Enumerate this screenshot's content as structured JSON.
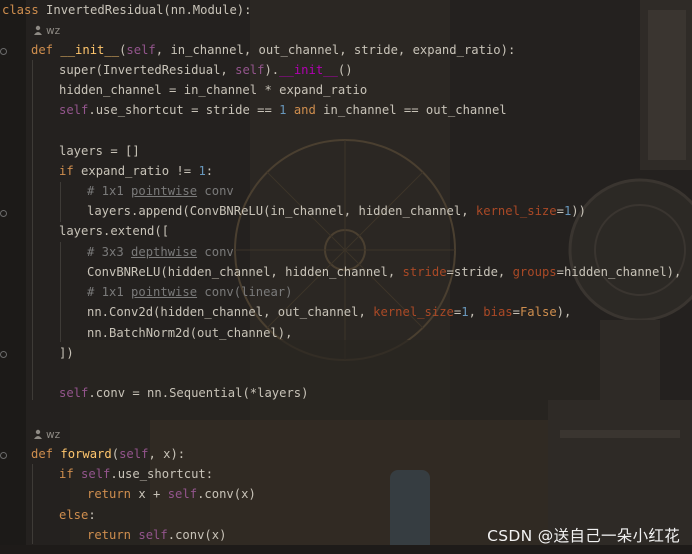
{
  "theme": {
    "background": "#24211f",
    "keyword": "#cf8e4e",
    "self": "#94558d",
    "function": "#ffc66d",
    "number": "#6897bb",
    "comment": "#7a7a7a",
    "kwarg": "#aa4926",
    "magic": "#b200b2"
  },
  "author_icon": "user-icon",
  "code": {
    "class_line": [
      "class ",
      "InvertedResidual(nn.Module):"
    ],
    "author_1": "wz",
    "init_def": [
      "def ",
      "__init__",
      "(",
      "self",
      ", in_channel, out_channel, stride, expand_ratio):"
    ],
    "super_call": [
      "super(InvertedResidual, ",
      "self",
      ").",
      "__init__",
      "()"
    ],
    "hidden": [
      "hidden_channel = in_channel * expand_ratio"
    ],
    "shortcut": [
      "self",
      ".use_shortcut = stride == ",
      "1",
      " ",
      "and",
      " in_channel == out_channel"
    ],
    "layers_init": [
      "layers = []"
    ],
    "if_expand": [
      "if",
      " expand_ratio != ",
      "1",
      ":"
    ],
    "comment_1": [
      "# 1x1 ",
      "pointwise",
      " conv"
    ],
    "append": [
      "layers.append(ConvBNReLU(in_channel, hidden_channel, ",
      "kernel_size",
      "=",
      "1",
      "))"
    ],
    "extend": [
      "layers.extend(["
    ],
    "comment_2": [
      "# 3x3 ",
      "depthwise",
      " conv"
    ],
    "convbn": [
      "ConvBNReLU(hidden_channel, hidden_channel, ",
      "stride",
      "=stride, ",
      "groups",
      "=hidden_channel),"
    ],
    "comment_3": [
      "# 1x1 ",
      "pointwise",
      " conv(linear)"
    ],
    "conv2d": [
      "nn.Conv2d(hidden_channel, out_channel, ",
      "kernel_size",
      "=",
      "1",
      ", ",
      "bias",
      "=",
      "False",
      "),"
    ],
    "bn": [
      "nn.BatchNorm2d(out_channel),"
    ],
    "close": [
      "])"
    ],
    "sequential": [
      "self",
      ".conv = nn.Sequential(*layers)"
    ],
    "author_2": "wz",
    "forward_def": [
      "def ",
      "forward",
      "(",
      "self",
      ", x):"
    ],
    "if_shortcut": [
      "if ",
      "self",
      ".use_shortcut:"
    ],
    "return_1": [
      "return",
      " x + ",
      "self",
      ".conv(x)"
    ],
    "else": [
      "else",
      ":"
    ],
    "return_2": [
      "return ",
      "self",
      ".conv(x)"
    ]
  },
  "watermark": "CSDN @送自己一朵小红花"
}
